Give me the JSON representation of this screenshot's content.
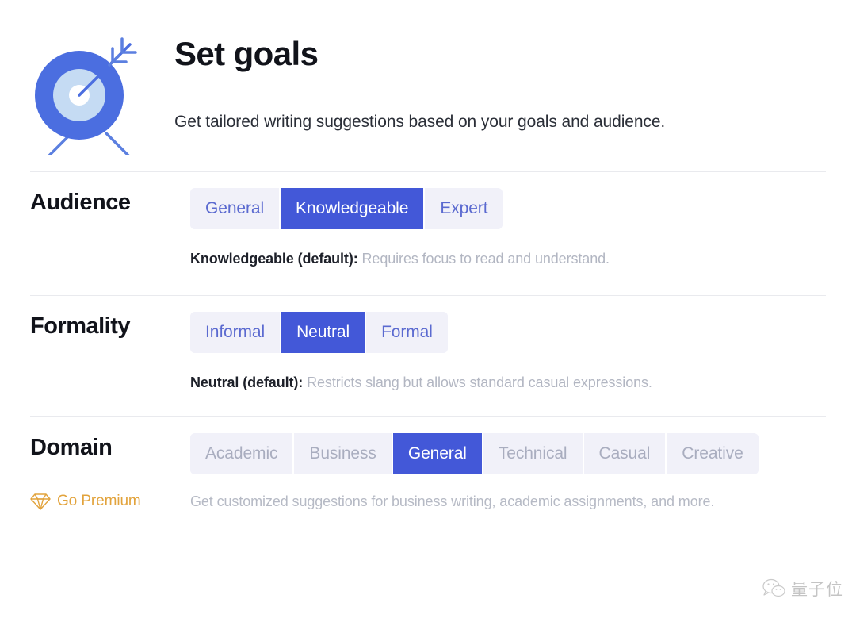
{
  "header": {
    "icon": "target-bullseye-arrow-icon",
    "title": "Set goals",
    "subtitle": "Get tailored writing suggestions based on your goals and audience."
  },
  "colors": {
    "accent_blue": "#4358d8",
    "segment_bg": "#f1f1f9",
    "segment_text": "#5b6ad0",
    "segment_text_disabled": "#a9adbf",
    "hint_desc": "#b2b6c2",
    "premium_gold": "#e2a33c",
    "divider": "#e9eaee",
    "title": "#11131a"
  },
  "rows": [
    {
      "label": "Audience",
      "disabled": false,
      "options": [
        "General",
        "Knowledgeable",
        "Expert"
      ],
      "selected": "Knowledgeable",
      "hint_strong": "Knowledgeable (default):",
      "hint_desc": "Requires focus to read and understand."
    },
    {
      "label": "Formality",
      "disabled": false,
      "options": [
        "Informal",
        "Neutral",
        "Formal"
      ],
      "selected": "Neutral",
      "hint_strong": "Neutral (default):",
      "hint_desc": "Restricts slang but allows standard casual expressions."
    },
    {
      "label": "Domain",
      "disabled": true,
      "options": [
        "Academic",
        "Business",
        "General",
        "Technical",
        "Casual",
        "Creative"
      ],
      "selected": "General",
      "hint_strong": "",
      "hint_desc": ""
    }
  ],
  "premium": {
    "icon": "diamond-gem-icon",
    "label": "Go Premium",
    "description": "Get customized suggestions for business writing, academic assignments, and more."
  },
  "watermark": {
    "icon": "wechat-icon",
    "text": "量子位"
  }
}
